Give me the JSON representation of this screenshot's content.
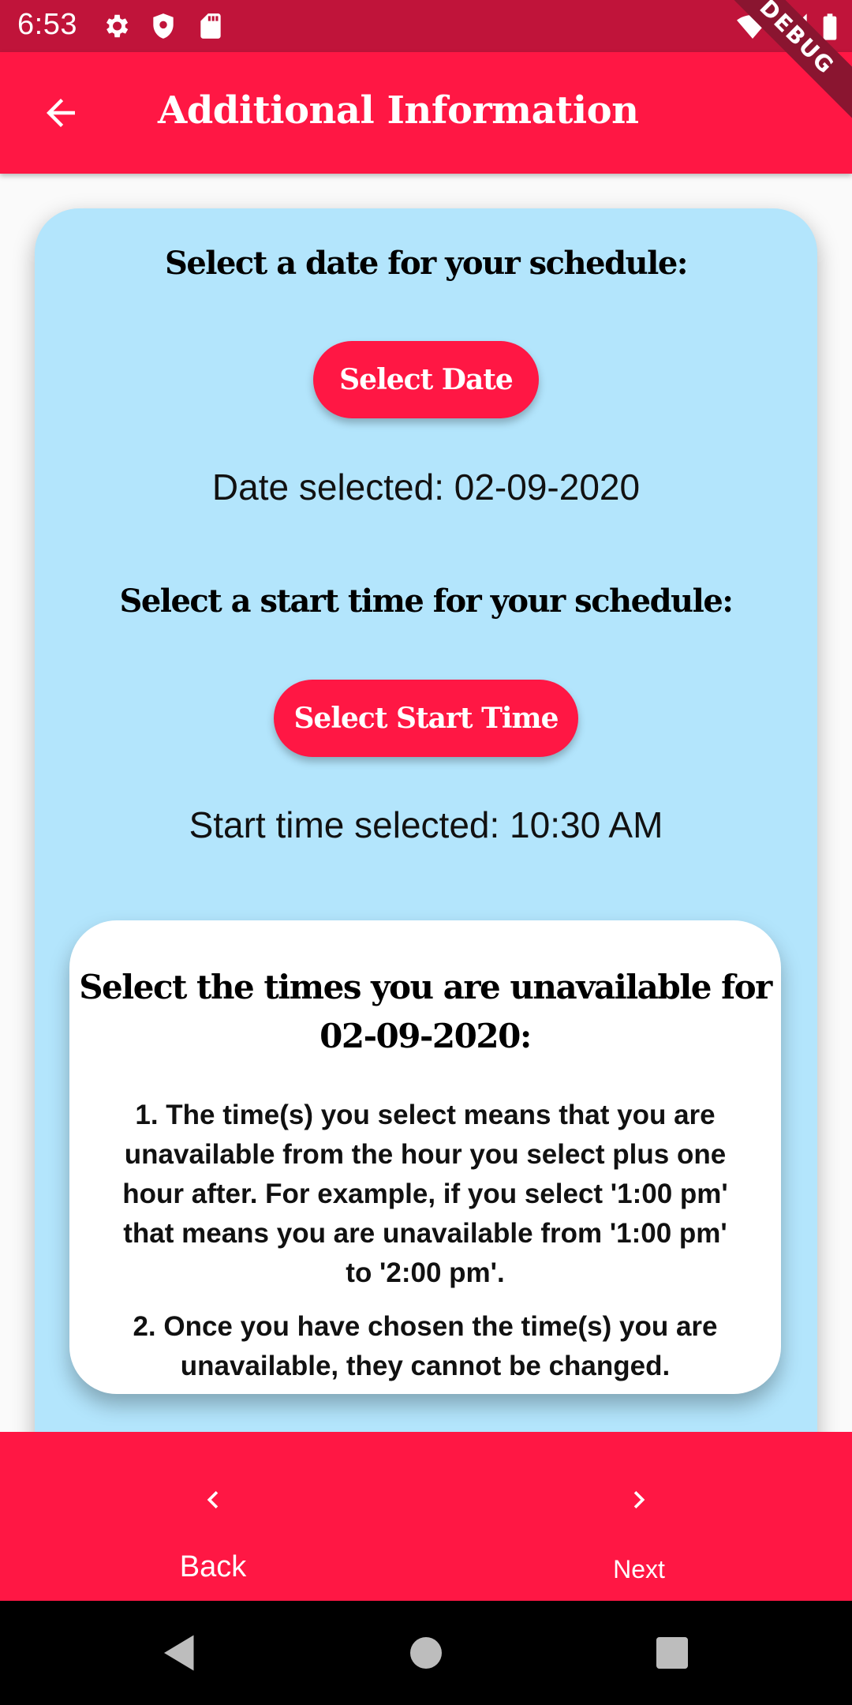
{
  "status_bar": {
    "time": "6:53",
    "debug_label": "DEBUG"
  },
  "app_bar": {
    "title": "Additional Information"
  },
  "schedule": {
    "date_heading": "Select a date for your schedule:",
    "date_button": "Select Date",
    "date_selected": "Date selected: 02-09-2020",
    "start_heading": "Select a start time for your schedule:",
    "start_button": "Select Start Time",
    "start_selected": "Start time selected: 10:30 AM"
  },
  "unavailable": {
    "heading_line1": "Select the times you are unavailable for",
    "heading_line2": "02-09-2020:",
    "rule1_line1": "1.   The time(s) you select means that you are",
    "rule1_line2": "unavailable from the hour you select plus one",
    "rule1_line3": "hour after. For example, if you select '1:00 pm'",
    "rule1_line4": "that means you are unavailable from '1:00 pm'",
    "rule1_line5": "to '2:00 pm'.",
    "rule2_line1": "2.   Once you have chosen the time(s) you are",
    "rule2_line2": "unavailable, they cannot be changed."
  },
  "bottom_nav": {
    "back_label": "Back",
    "next_label": "Next"
  },
  "colors": {
    "status_bar": "#c0143a",
    "primary": "#ff1744",
    "card_bg": "#b3e5fc",
    "inner_card_bg": "#ffffff"
  },
  "icons": {
    "status": [
      "gear-icon",
      "shield-icon",
      "sd-card-icon",
      "wifi-icon",
      "signal-icon",
      "battery-icon"
    ],
    "app_bar": "arrow-back-icon",
    "bottom_nav": [
      "chevron-left-icon",
      "chevron-right-icon"
    ],
    "system_nav": [
      "nav-back-icon",
      "nav-home-icon",
      "nav-recents-icon"
    ]
  }
}
